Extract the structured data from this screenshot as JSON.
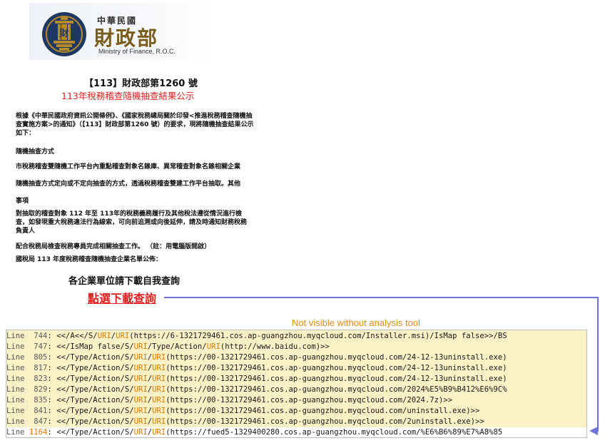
{
  "logo": {
    "title_small": "中華民國",
    "title_big": "財政部",
    "title_en": "Ministry of Finance, R.O.C.",
    "seal_char": "財",
    "seal_color": "#1f3763",
    "gold_color": "#b58a2a"
  },
  "document": {
    "doc_number": "【113】財政部第1260 號",
    "title": "113年稅務稽查隨機抽查結果公示",
    "para1": "根據《中華民國政府資訊公開條例》、《國家稅務總局關於印發<推進稅務稽查隨機抽查實施方案>的通知》（【113】財政部第1260 號）的要求，現將隨機抽查結果公示如下：",
    "heading1": "隨機抽查方式",
    "para2": "市稅務稽查雙隨機工作平台內重點稽查對象名錄庫、異常稽查對象名錄相關企業",
    "para3": "隨機抽查方式定向或不定向抽查的方式，透過稅務稽查雙建工作平台抽取。其他",
    "heading2": "事項",
    "para4": "對抽取的稽查對象 112 年至 113年的稅務義務履行及其他稅法遵從情況進行檢查，如發現重大稅務違法行為線索，可向前追溯或向後延伸，請及時通知財務稅務負責人",
    "para5": "配合稅務局檢查稅務專員完成相關抽查工作。 （註：用電腦版開啟）",
    "para6": "國稅局 113 年度稅務稽查隨機抽查企業名單公佈：",
    "notice": "各企業單位請下載自我查詢",
    "download_link": "點選下載查詢"
  },
  "annotation": {
    "caption": "Not visible without analysis tool",
    "arrow_color": "#6f73d6"
  },
  "code_view": {
    "label": "Line",
    "lines": [
      {
        "num": "744",
        "pre": "<</A<</S/",
        "k1": "URI",
        "mid": "/",
        "k2": "URI",
        "post": "(https://6-1321729461.cos.ap-guangzhou.myqcloud.com/Installer.msi)/IsMap false>>/BS"
      },
      {
        "num": "747",
        "pre": "<</IsMap false/S/",
        "k1": "URI",
        "mid": "/Type/Action/",
        "k2": "URI",
        "post": "(http://www.baidu.com)>>"
      },
      {
        "num": "805",
        "pre": "<</Type/Action/S/",
        "k1": "URI",
        "mid": "/",
        "k2": "URI",
        "post": "(https://00-1321729461.cos.ap-guangzhou.myqcloud.com/24-12-13uninstall.exe)"
      },
      {
        "num": "817",
        "pre": "<</Type/Action/S/",
        "k1": "URI",
        "mid": "/",
        "k2": "URI",
        "post": "(https://00-1321729461.cos.ap-guangzhou.myqcloud.com/24-12-13uninstall.exe)"
      },
      {
        "num": "823",
        "pre": "<</Type/Action/S/",
        "k1": "URI",
        "mid": "/",
        "k2": "URI",
        "post": "(https://00-1321729461.cos.ap-guangzhou.myqcloud.com/24-12-13uninstall.exe)"
      },
      {
        "num": "829",
        "pre": "<</Type/Action/S/",
        "k1": "URI",
        "mid": "/",
        "k2": "URI",
        "post": "(https://00-1321729461.cos.ap-guangzhou.myqcloud.com/2024%E5%B9%B412%E6%9C%"
      },
      {
        "num": "835",
        "pre": "<</Type/Action/S/",
        "k1": "URI",
        "mid": "/",
        "k2": "URI",
        "post": "(https://00-1321729461.cos.ap-guangzhou.myqcloud.com/2024.7z)>>"
      },
      {
        "num": "841",
        "pre": "<</Type/Action/S/",
        "k1": "URI",
        "mid": "/",
        "k2": "URI",
        "post": "(https://00-1321729461.cos.ap-guangzhou.myqcloud.com/uninstall.exe)>>"
      },
      {
        "num": "847",
        "pre": "<</Type/Action/S/",
        "k1": "URI",
        "mid": "/",
        "k2": "URI",
        "post": "(https://00-1321729461.cos.ap-guangzhou.myqcloud.com/2uninstall.exe)>>"
      },
      {
        "num": "1164",
        "pre": "<</Type/Action/S/",
        "k1": "URI",
        "mid": "/",
        "k2": "URI",
        "post": "(https://fued5-1329400280.cos.ap-guangzhou.myqcloud.com/%E6%B6%89%E7%A8%85"
      }
    ]
  }
}
